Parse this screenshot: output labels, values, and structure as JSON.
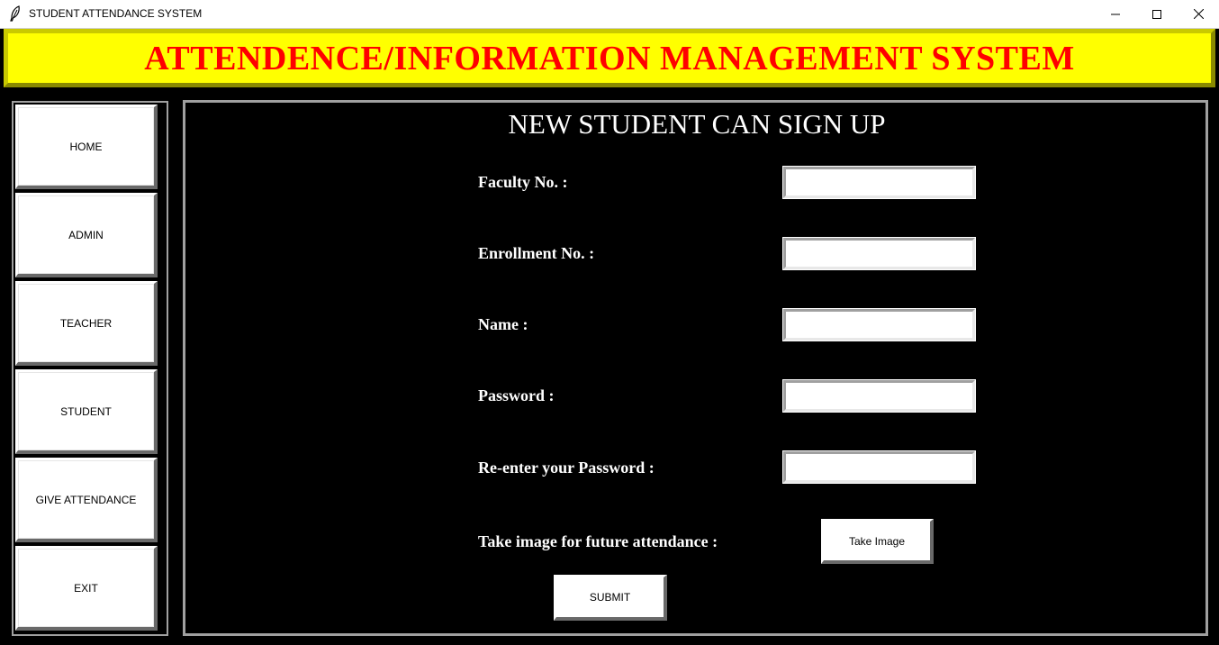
{
  "window": {
    "title": "STUDENT ATTENDANCE SYSTEM",
    "icon": "feather-icon",
    "controls": [
      "minimize-icon",
      "maximize-icon",
      "close-icon"
    ]
  },
  "header": {
    "title": "ATTENDENCE/INFORMATION MANAGEMENT SYSTEM",
    "background_color": "#ffff00",
    "text_color": "#ff0000"
  },
  "sidebar": {
    "items": [
      {
        "label": "HOME"
      },
      {
        "label": "ADMIN"
      },
      {
        "label": "TEACHER"
      },
      {
        "label": "STUDENT"
      },
      {
        "label": "GIVE ATTENDANCE"
      },
      {
        "label": "EXIT"
      }
    ]
  },
  "main": {
    "title": "NEW STUDENT CAN SIGN UP",
    "fields": [
      {
        "label": "Faculty No. :",
        "value": ""
      },
      {
        "label": "Enrollment No. :",
        "value": ""
      },
      {
        "label": "Name :",
        "value": ""
      },
      {
        "label": "Password :",
        "value": ""
      },
      {
        "label": "Re-enter your Password :",
        "value": ""
      }
    ],
    "image_prompt": "Take image for future attendance :",
    "take_image_label": "Take Image",
    "submit_label": "SUBMIT"
  }
}
